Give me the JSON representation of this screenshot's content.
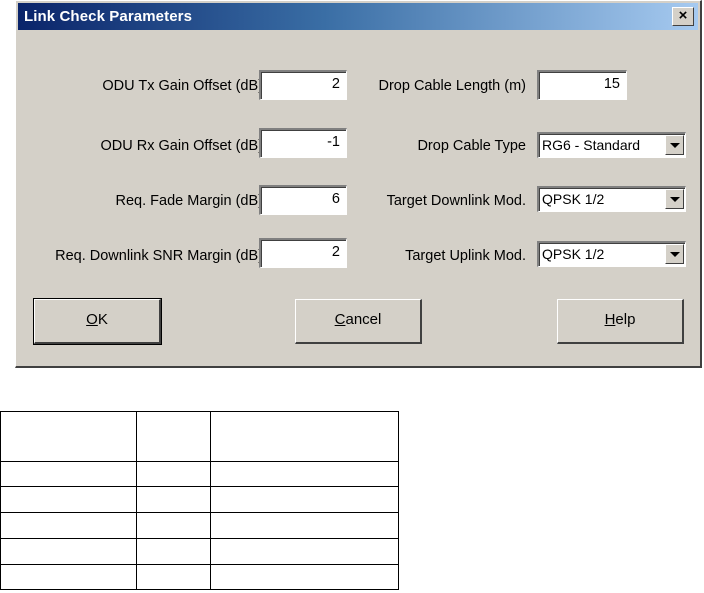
{
  "dialog": {
    "title": "Link Check Parameters",
    "close_glyph": "×"
  },
  "left_fields": [
    {
      "label": "ODU Tx Gain Offset (dB)",
      "value": "2"
    },
    {
      "label": "ODU Rx Gain Offset (dB)",
      "value": "-1"
    },
    {
      "label": "Req. Fade Margin (dB)",
      "value": "6"
    },
    {
      "label": "Req. Downlink SNR Margin (dB)",
      "value": "2"
    }
  ],
  "right_fields": {
    "drop_cable_length": {
      "label": "Drop Cable Length (m)",
      "value": "15"
    },
    "drop_cable_type": {
      "label": "Drop Cable Type",
      "value": "RG6 - Standard"
    },
    "target_downlink_mod": {
      "label": "Target Downlink Mod.",
      "value": "QPSK 1/2"
    },
    "target_uplink_mod": {
      "label": "Target Uplink Mod.",
      "value": "QPSK 1/2"
    }
  },
  "buttons": {
    "ok": {
      "mnemonic": "O",
      "rest": "K"
    },
    "cancel": {
      "mnemonic": "C",
      "rest": "ancel"
    },
    "help": {
      "mnemonic": "H",
      "rest": "elp"
    }
  },
  "table": {
    "rows": [
      [
        "",
        "",
        ""
      ],
      [
        "",
        "",
        ""
      ],
      [
        "",
        "",
        ""
      ],
      [
        "",
        "",
        ""
      ],
      [
        "",
        "",
        ""
      ],
      [
        "",
        "",
        ""
      ]
    ]
  }
}
